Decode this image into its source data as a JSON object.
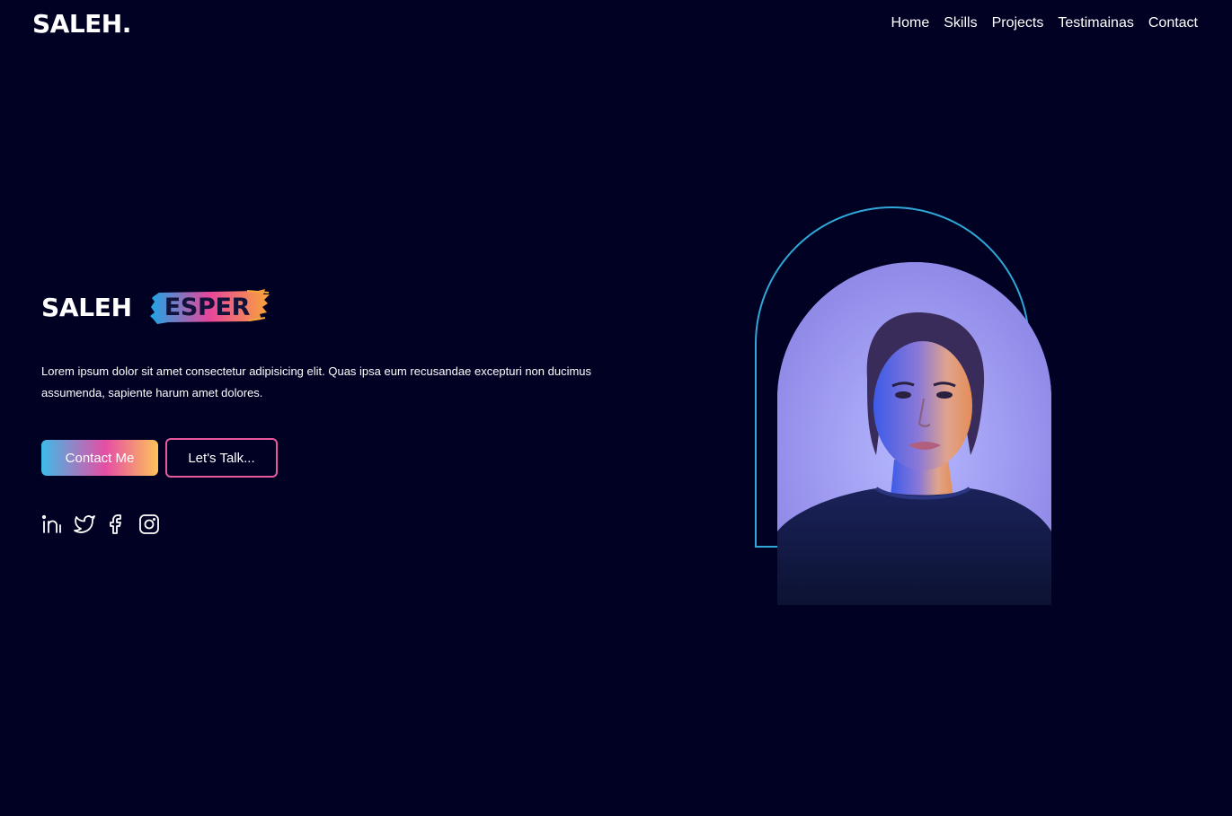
{
  "logo": "SALEH.",
  "nav": {
    "items": [
      "Home",
      "Skills",
      "Projects",
      "Testimainas",
      "Contact"
    ]
  },
  "hero": {
    "first_name": "SALEH",
    "last_name": "ESPER",
    "description": "Lorem ipsum dolor sit amet consectetur adipisicing elit. Quas ipsa eum recusandae excepturi non ducimus assumenda, sapiente harum amet dolores.",
    "primary_button": "Contact Me",
    "secondary_button": "Let's Talk..."
  },
  "socials": {
    "icons": [
      "linkedin-icon",
      "twitter-icon",
      "facebook-icon",
      "instagram-icon"
    ]
  },
  "colors": {
    "background": "#010124",
    "accent_blue": "#3ebbe8",
    "accent_pink": "#e64ea4",
    "accent_yellow": "#fdc35a",
    "arch_outline": "#2fa8d8"
  }
}
